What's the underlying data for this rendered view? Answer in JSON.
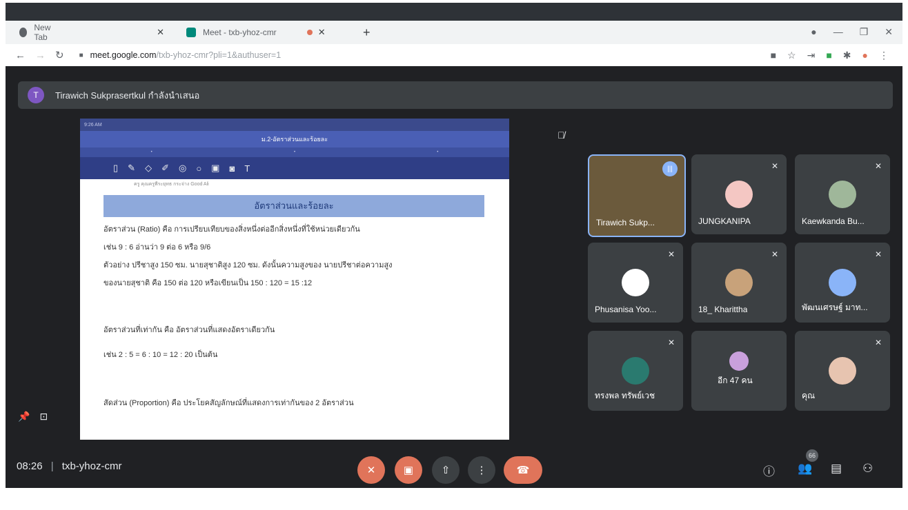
{
  "browser": {
    "tabs": [
      {
        "title": "New Tab"
      },
      {
        "title": "Meet - txb-yhoz-cmr"
      }
    ],
    "url_domain": "meet.google.com",
    "url_path": "/txb-yhoz-cmr?pli=1&authuser=1"
  },
  "banner": {
    "avatar_letter": "T",
    "text": "Tirawich Sukprasertkul กำลังนำเสนอ"
  },
  "presentation": {
    "doc_title": "ม.2-อัตราส่วนและร้อยละ",
    "heading": "อัตราส่วนและร้อยละ",
    "small_text": "ครู คุณครูพีระยุทธ กระจ่าง Good Ali",
    "lines": [
      "อัตราส่วน (Ratio) คือ การเปรียบเทียบของสิ่งหนึ่งต่ออีกสิ่งหนึ่งที่ใช้หน่วยเดียวกัน",
      "เช่น 9 : 6 อ่านว่า 9 ต่อ 6 หรือ 9/6",
      "ตัวอย่าง ปรีชาสูง 150 ซม. นายสุชาติสูง 120 ซม. ดังนั้นความสูงของ นายปรีชาต่อความสูง",
      "ของนายสุชาติ คือ 150 ต่อ 120 หรือเขียนเป็น 150 : 120 = 15 :12",
      "อัตราส่วนที่เท่ากัน คือ อัตราส่วนที่แสดงอัตราเดียวกัน",
      "เช่น 2 : 5 = 6 : 10 = 12 : 20 เป็นต้น",
      "สัดส่วน (Proportion) คือ ประโยคสัญลักษณ์ที่แสดงการเท่ากันของ 2 อัตราส่วน"
    ]
  },
  "participants": [
    {
      "name": "Tirawich Sukp...",
      "speaking": true
    },
    {
      "name": "JUNGKANIPA",
      "muted": true
    },
    {
      "name": "Kaewkanda Bu...",
      "muted": true
    },
    {
      "name": "Phusanisa Yoo...",
      "muted": true
    },
    {
      "name": "18_ Kharittha",
      "muted": true
    },
    {
      "name": "พัฒนเศรษฐ์ มาท...",
      "muted": true
    },
    {
      "name": "ทรงพล ทรัพย์เวช",
      "muted": true
    },
    {
      "name": "อีก 47 คน",
      "muted": false
    },
    {
      "name": "คุณ",
      "muted": true
    }
  ],
  "bottom_bar": {
    "time": "08:26",
    "meeting_code": "txb-yhoz-cmr",
    "people_count": "66"
  }
}
